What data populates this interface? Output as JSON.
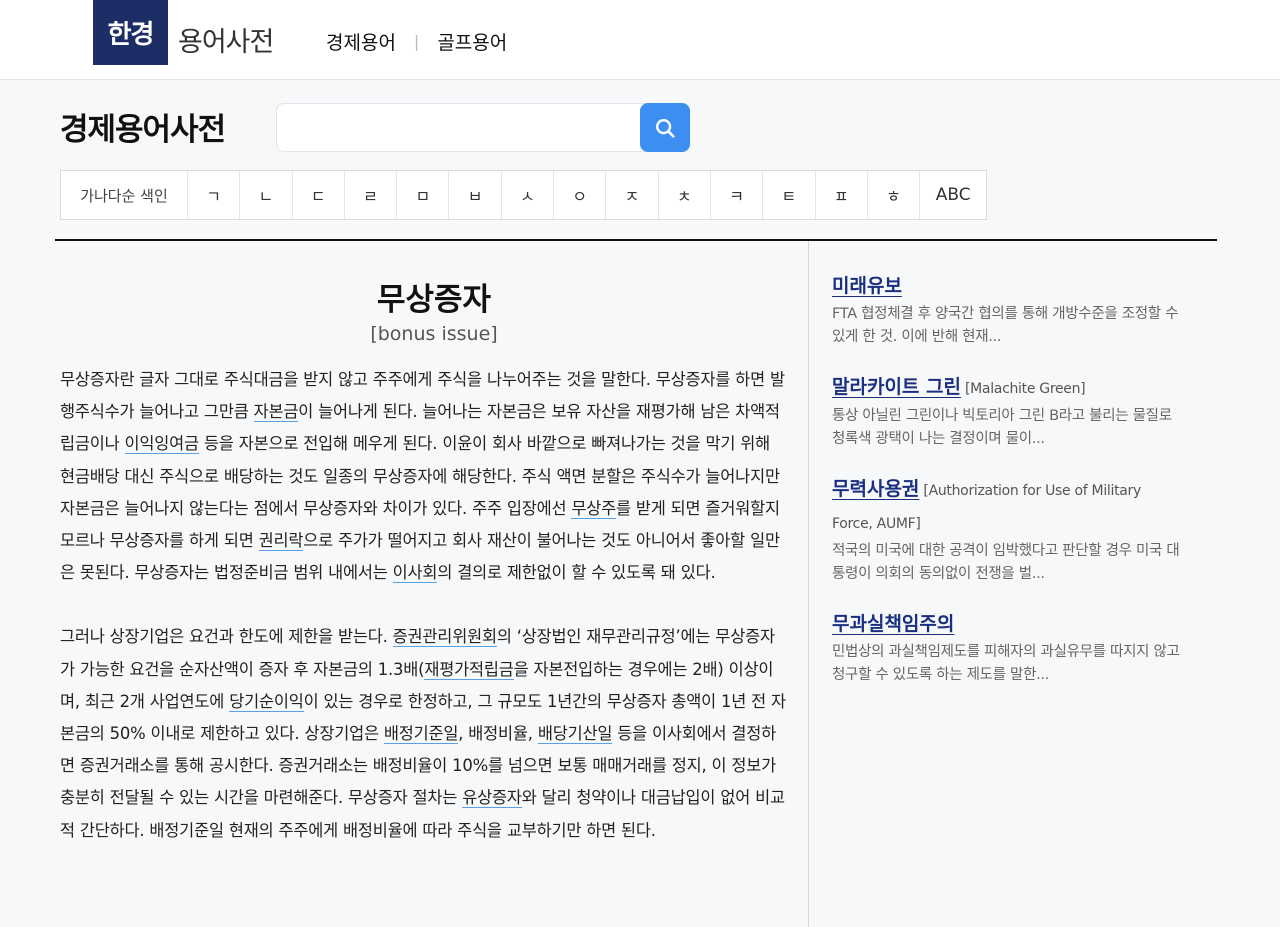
{
  "header": {
    "logo_mark": "한경",
    "logo_text": "용어사전",
    "nav": [
      {
        "label": "경제용어"
      },
      {
        "label": "골프용어"
      }
    ],
    "nav_separator": "|"
  },
  "search": {
    "title": "경제용어사전",
    "value": "",
    "placeholder": ""
  },
  "index": {
    "label": "가나다순 색인",
    "letters": [
      "ㄱ",
      "ㄴ",
      "ㄷ",
      "ㄹ",
      "ㅁ",
      "ㅂ",
      "ㅅ",
      "ㅇ",
      "ㅈ",
      "ㅊ",
      "ㅋ",
      "ㅌ",
      "ㅍ",
      "ㅎ"
    ],
    "abc": "ABC"
  },
  "term": {
    "title": "무상증자",
    "english": "[bonus issue]",
    "para1": [
      {
        "t": "무상증자란 글자 그대로 주식대금을 받지 않고 주주에게 주식을 나누어주는 것을 말한다. 무상증자를 하면 발행주식수가 늘어나고 그만큼 "
      },
      {
        "t": "자본금",
        "link": true
      },
      {
        "t": "이 늘어나게 된다. 늘어나는 자본금은 보유 자산을 재평가해 남은 차액적립금이나 "
      },
      {
        "t": "이익잉여금",
        "link": true
      },
      {
        "t": " 등을 자본으로 전입해 메우게 된다. 이윤이 회사 바깥으로 빠져나가는 것을 막기 위해 현금배당 대신 주식으로 배당하는 것도 일종의 무상증자에 해당한다. 주식 액면 분할은 주식수가 늘어나지만 자본금은 늘어나지 않는다는 점에서 무상증자와 차이가 있다. 주주 입장에선 "
      },
      {
        "t": "무상주",
        "link": true
      },
      {
        "t": "를 받게 되면 즐거워할지 모르나 무상증자를 하게 되면 "
      },
      {
        "t": "권리락",
        "link": true
      },
      {
        "t": "으로 주가가 떨어지고 회사 재산이 불어나는 것도 아니어서 좋아할 일만은 못된다. 무상증자는 법정준비금 범위 내에서는 "
      },
      {
        "t": "이사회",
        "link": true
      },
      {
        "t": "의 결의로 제한없이 할 수 있도록 돼 있다."
      }
    ],
    "para2": [
      {
        "t": "그러나 상장기업은 요건과 한도에 제한을 받는다. "
      },
      {
        "t": "증권관리위원회",
        "link": true
      },
      {
        "t": "의 ‘상장법인 재무관리규정’에는 무상증자가 가능한 요건을 순자산액이 증자 후 자본금의 1.3배("
      },
      {
        "t": "재평가적립금",
        "link": true
      },
      {
        "t": "을 자본전입하는 경우에는 2배) 이상이며, 최근 2개 사업연도에 "
      },
      {
        "t": "당기순이익",
        "link": true
      },
      {
        "t": "이 있는 경우로 한정하고, 그 규모도 1년간의 무상증자 총액이 1년 전 자본금의 50% 이내로 제한하고 있다. 상장기업은 "
      },
      {
        "t": "배정기준일",
        "link": true
      },
      {
        "t": ", 배정비율, "
      },
      {
        "t": "배당기산일",
        "link": true
      },
      {
        "t": " 등을 이사회에서 결정하면 증권거래소를 통해 공시한다. 증권거래소는 배정비율이 10%를 넘으면 보통 매매거래를 정지, 이 정보가 충분히 전달될 수 있는 시간을 마련해준다. 무상증자 절차는 "
      },
      {
        "t": "유상증자",
        "link": true
      },
      {
        "t": "와 달리 청약이나 대금납입이 없어 비교적 간단하다. 배정기준일 현재의 주주에게 배정비율에 따라 주식을 교부하기만 하면 된다."
      }
    ]
  },
  "sidebar": {
    "items": [
      {
        "title": "미래유보",
        "english": "",
        "desc": "FTA 협정체결 후 양국간 협의를 통해 개방수준을 조정할 수 있게 한 것. 이에 반해 현재..."
      },
      {
        "title": "말라카이트 그린",
        "english": "[Malachite Green]",
        "desc": "통상 아닐린 그린이나 빅토리아 그린 B라고 불리는 물질로 청록색 광택이 나는 결정이며 물이..."
      },
      {
        "title": "무력사용권",
        "english": "[Authorization for Use of Military Force, AUMF]",
        "desc": "적국의 미국에 대한 공격이 임박했다고 판단할 경우 미국 대통령이 의회의 동의없이 전쟁을 벌..."
      },
      {
        "title": "무과실책임주의",
        "english": "",
        "desc": "민법상의 과실책임제도를 피해자의 과실유무를 따지지 않고 청구할 수 있도록 하는 제도를 말한..."
      }
    ]
  },
  "icons": {
    "search": "search-icon"
  },
  "colors": {
    "brand_navy": "#1d2e66",
    "search_button": "#3c8ef0",
    "side_title": "#1a2f80",
    "link_underline": "#5aa0e8"
  }
}
